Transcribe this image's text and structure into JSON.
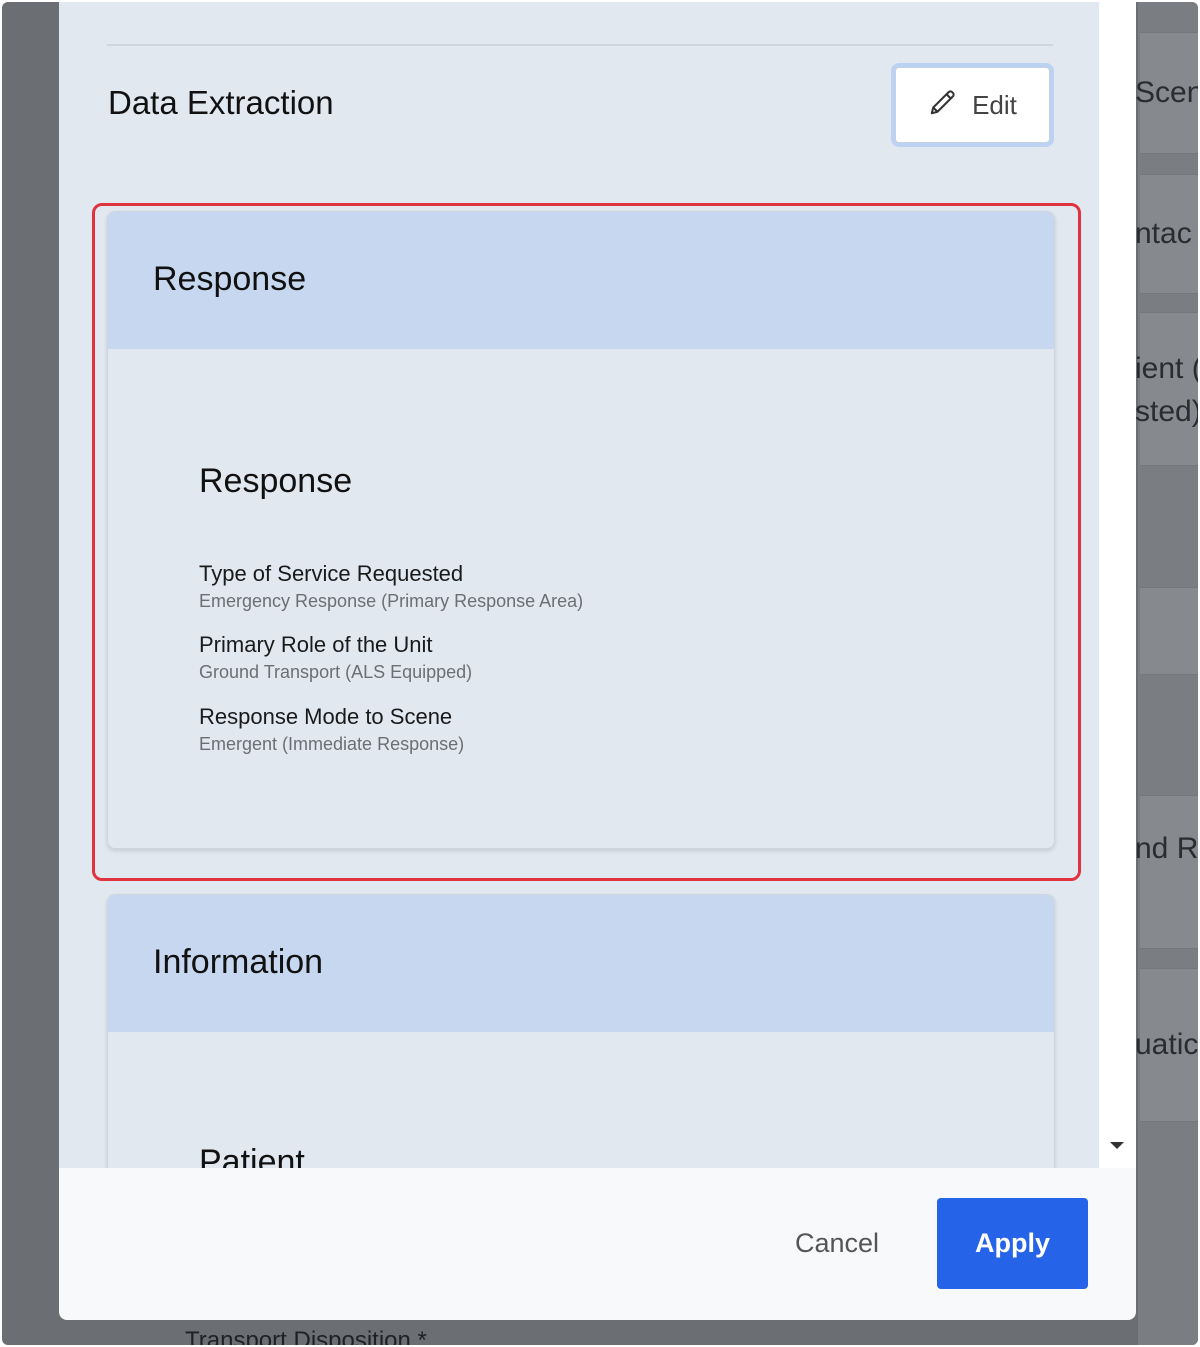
{
  "background": {
    "fragments": [
      "Scen",
      "ntac",
      "ient (",
      "sted)",
      "nd Re",
      "uatic"
    ],
    "bottom_label": "Transport Disposition *"
  },
  "modal": {
    "section_title": "Data Extraction",
    "edit_label": "Edit",
    "cards": [
      {
        "header": "Response",
        "subsection": "Response",
        "fields": [
          {
            "label": "Type of Service Requested",
            "value": "Emergency Response (Primary Response Area)"
          },
          {
            "label": "Primary Role of the Unit",
            "value": "Ground Transport (ALS Equipped)"
          },
          {
            "label": "Response Mode to Scene",
            "value": "Emergent (Immediate Response)"
          }
        ]
      },
      {
        "header": "Information",
        "subsection": "Patient"
      }
    ],
    "footer": {
      "cancel_label": "Cancel",
      "apply_label": "Apply"
    }
  },
  "colors": {
    "accent": "#2563e8",
    "highlight": "#e0333f",
    "card_header": "#c6d7ef"
  }
}
